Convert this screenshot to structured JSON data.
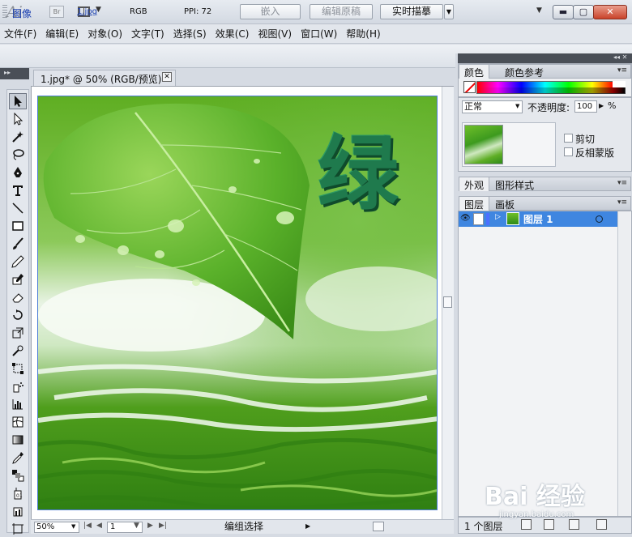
{
  "titlebar": {
    "app_logo": "Ai",
    "bridge_label": "Br",
    "window_buttons": {
      "minimize": "▬",
      "maximize": "▢",
      "close": "✕"
    }
  },
  "menubar": {
    "items": [
      "文件(F)",
      "编辑(E)",
      "对象(O)",
      "文字(T)",
      "选择(S)",
      "效果(C)",
      "视图(V)",
      "窗口(W)",
      "帮助(H)"
    ]
  },
  "controlbar": {
    "object_type": "图像",
    "file_name": "1.jpg",
    "color_mode": "RGB",
    "ppi": "PPI: 72",
    "embed_label": "嵌入",
    "edit_original_label": "编辑原稿",
    "live_trace_label": "实时描摹"
  },
  "document": {
    "tab_title": "1.jpg* @ 50% (RGB/预览)",
    "canvas_text": "绿"
  },
  "statusbar": {
    "zoom": "50%",
    "page": "1",
    "status": "编组选择"
  },
  "panels": {
    "color_tab": "颜色",
    "color_guide_tab": "颜色参考",
    "blend_mode": "正常",
    "opacity_label": "不透明度:",
    "opacity_value": "100",
    "opacity_unit": "%",
    "clip_label": "剪切",
    "invert_mask_label": "反相蒙版",
    "appearance_tab": "外观",
    "graphic_styles_tab": "图形样式",
    "layers_tab": "图层",
    "artboards_tab": "画板",
    "layer_name": "图层 1",
    "layer_count": "1 个图层"
  },
  "watermark": {
    "logo": "Bai 经验",
    "url": "jingyan.baidu.com"
  },
  "colors": {
    "layer_highlight": "#3f86e0",
    "canvas_text_color": "#1f7a4d"
  }
}
